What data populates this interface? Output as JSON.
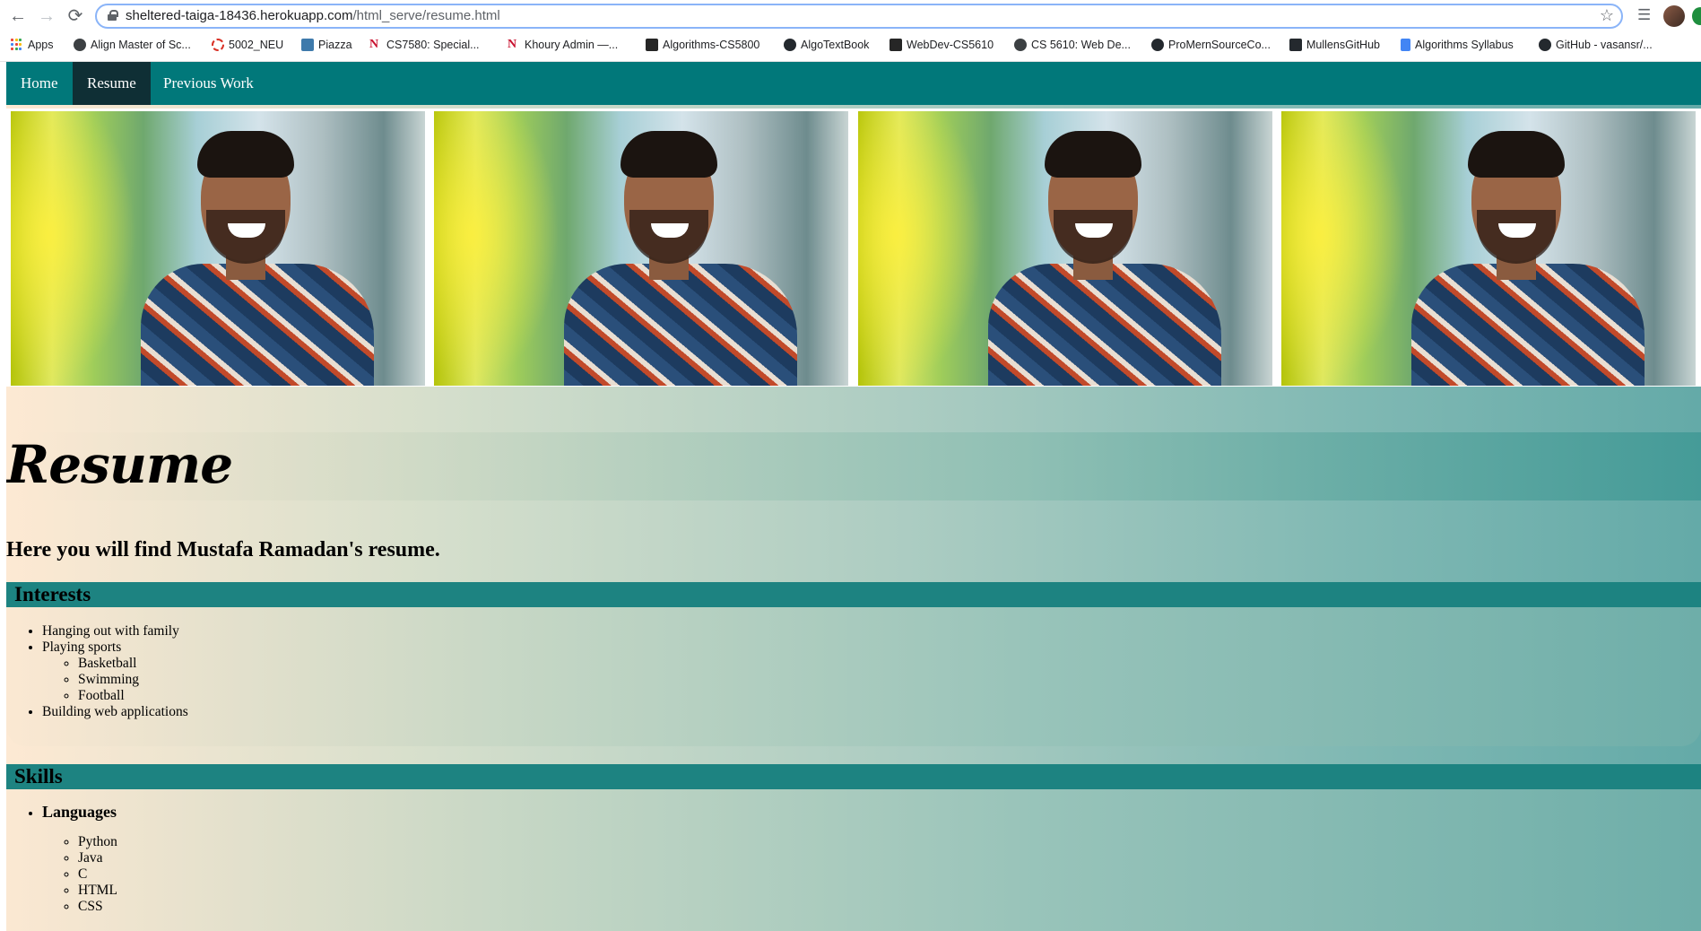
{
  "browser": {
    "url_host": "sheltered-taiga-18436.herokuapp.com",
    "url_path": "/html_serve/resume.html",
    "bookmarks": [
      {
        "label": "Apps",
        "icon": "apps-grid-icon"
      },
      {
        "label": "Align Master of Sc...",
        "icon": "globe-icon"
      },
      {
        "label": "5002_NEU",
        "icon": "circle-dashed-icon"
      },
      {
        "label": "Piazza",
        "icon": "piazza-icon"
      },
      {
        "label": "CS7580: Special...",
        "icon": "northeastern-icon"
      },
      {
        "label": "Khoury Admin —...",
        "icon": "northeastern-icon"
      },
      {
        "label": "Algorithms-CS5800",
        "icon": "blackboard-icon"
      },
      {
        "label": "AlgoTextBook",
        "icon": "github-icon"
      },
      {
        "label": "WebDev-CS5610",
        "icon": "blackboard-icon"
      },
      {
        "label": "CS 5610: Web De...",
        "icon": "globe-icon"
      },
      {
        "label": "ProMernSourceCo...",
        "icon": "github-icon"
      },
      {
        "label": "MullensGitHub",
        "icon": "github-icon"
      },
      {
        "label": "Algorithms Syllabus",
        "icon": "docs-icon"
      },
      {
        "label": "GitHub - vasansr/...",
        "icon": "github-icon"
      }
    ]
  },
  "nav": {
    "home": "Home",
    "resume": "Resume",
    "previous_work": "Previous Work"
  },
  "page": {
    "title": "Resume",
    "subtitle": "Here you will find Mustafa Ramadan's resume."
  },
  "interests": {
    "heading": "Interests",
    "items": [
      "Hanging out with family",
      "Playing sports",
      "Building web applications"
    ],
    "sports": [
      "Basketball",
      "Swimming",
      "Football"
    ]
  },
  "skills": {
    "heading": "Skills",
    "languages_label": "Languages",
    "languages": [
      "Python",
      "Java",
      "C",
      "HTML",
      "CSS"
    ]
  },
  "colors": {
    "nav_bg": "#01787a",
    "nav_active": "#0f2f35",
    "section_head": "#1d8381"
  }
}
